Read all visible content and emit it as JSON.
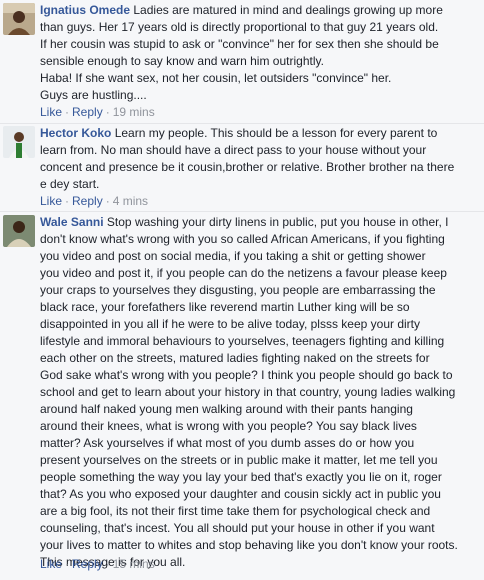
{
  "comments": [
    {
      "author": "Ignatius Omede",
      "lines": [
        "Ladies are matured in mind and dealings growing up more",
        "than guys. Her 17 years old is directly proportional to that guy 21 years old.",
        "If her cousin was stupid to ask or \"convince\" her for sex then she should be",
        "sensible enough to say know and warn him outrightly.",
        "Haba! If she want sex, not her cousin, let outsiders \"convince\" her.",
        "Guys are hustling...."
      ],
      "like": "Like",
      "reply": "Reply",
      "time": "19 mins"
    },
    {
      "author": "Hector Koko",
      "lines": [
        "Learn my people. This should be a lesson for every parent to",
        "learn from. No man should have a direct pass to your house without your",
        "concent and presence be it cousin,brother or relative. Brother brother na there",
        "e dey start."
      ],
      "like": "Like",
      "reply": "Reply",
      "time": "4 mins"
    },
    {
      "author": "Wale Sanni",
      "lines": [
        "Stop washing your dirty linens in public, put you house in other, I",
        "don't know what's wrong with you so called African Americans, if you fighting",
        "you video and post on social media, if you taking a shit or getting shower",
        "you video and post it, if you people can do the netizens a favour please keep",
        "your craps to yourselves they disgusting, you people are embarrassing the",
        "black race, your forefathers like reverend martin Luther king will be so",
        "disappointed in you all if he were to be alive today, plsss keep your dirty",
        "lifestyle and immoral behaviours to yourselves, teenagers fighting and killing",
        "each other on the streets, matured ladies fighting naked on the streets for",
        "God sake what's wrong with you people? I think you people should go back to",
        "school and get to learn about your history in that country, young ladies walking",
        "around half naked young men walking around with their pants hanging",
        "around their knees, what is wrong with you people? You say black lives",
        "matter? Ask yourselves if what most of you dumb asses do or how you",
        "present yourselves on the streets or in public make it matter, let me tell you",
        "people something the way you lay your bed that's exactly you lie on it, roger",
        "that? As you who exposed your daughter and cousin sickly act in public you",
        "are a big fool, its not their first time take them for psychological check and",
        "counseling, that's incest. You all should put your house in other if you want",
        "your lives to matter to whites and stop behaving like you don't know your roots.",
        "This message is for you all."
      ],
      "like": "Like",
      "reply": "Reply",
      "time": "15 mins"
    }
  ]
}
